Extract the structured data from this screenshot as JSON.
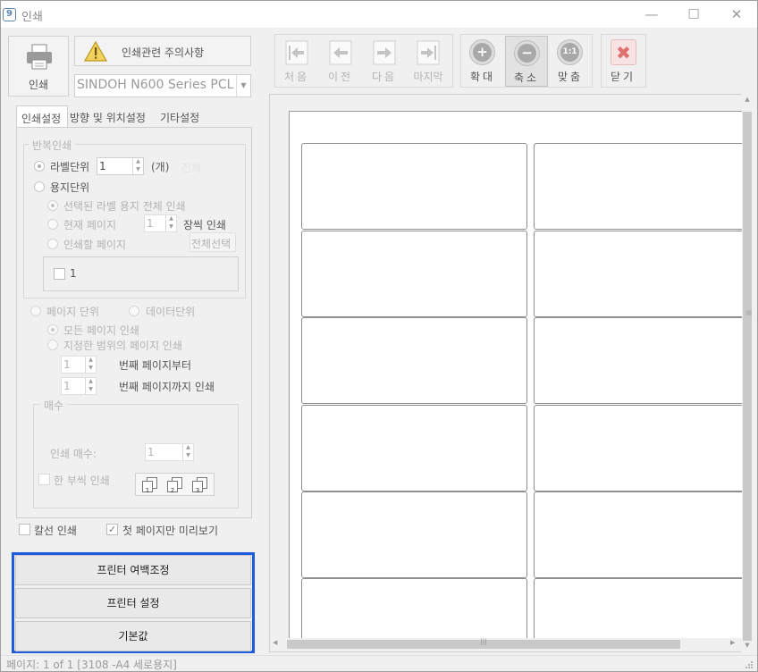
{
  "window": {
    "title": "인쇄",
    "app_icon_glyph": "9",
    "minimize_glyph": "—",
    "maximize_glyph": "☐",
    "close_glyph": "✕"
  },
  "top": {
    "print_button": "인쇄",
    "notice_button": "인쇄관련 주의사항",
    "printer_select": "SINDOH N600 Series PCL",
    "printer_arrow": "▼"
  },
  "toolbar": {
    "first": "처음",
    "prev": "이전",
    "next": "다음",
    "last": "마지막",
    "zoom_in": "확대",
    "zoom_out": "축소",
    "fit": "맞춤",
    "fit_glyph": "1:1",
    "close": "닫기",
    "plus_glyph": "+",
    "minus_glyph": "−",
    "close_x_glyph": "✖"
  },
  "tabs": [
    "인쇄설정",
    "방향 및 위치설정",
    "기타설정"
  ],
  "repeat": {
    "legend": "반복인쇄",
    "label_unit": "라벨단위",
    "label_count": "1",
    "label_count_unit": "(개)",
    "faded_text": "전체",
    "sheet_unit": "용지단위",
    "all_selected": "선택된 라벨 용지 전체 인쇄",
    "current_page": "현재 페이지",
    "current_count": "1",
    "sheet_print": "장씩 인쇄",
    "pages_to_print": "인쇄할 페이지",
    "select_all": "전체선택",
    "page_item": "1"
  },
  "page_mode": {
    "page_unit": "페이지 단위",
    "data_unit": "데이터단위",
    "all_pages": "모든 페이지 인쇄",
    "range_pages": "지정한 범위의 페이지 인쇄",
    "from_value": "1",
    "from_label": "번째 페이지부터",
    "to_value": "1",
    "to_label": "번째 페이지까지 인쇄"
  },
  "copies": {
    "legend": "매수",
    "count_label": "인쇄 매수:",
    "count_value": "1",
    "collate": "한 부씩 인쇄",
    "collate_icons": [
      "1",
      "2",
      "3"
    ]
  },
  "options": {
    "cut_line": "칼선 인쇄",
    "first_page_only": "첫 페이지만 미리보기",
    "first_page_only_checked": "✓"
  },
  "buttons": {
    "margin": "프린터 여백조정",
    "printer_settings": "프린터 설정",
    "default": "기본값"
  },
  "scroll": {
    "up": "▲",
    "down": "▼",
    "left": "◀",
    "right": "▶",
    "grip": "|||"
  },
  "status": "페이지: 1 of 1 [3108 -A4 세로용지]",
  "colors": {
    "highlight_border": "#1f5bdc",
    "close_icon": "#e07070"
  }
}
